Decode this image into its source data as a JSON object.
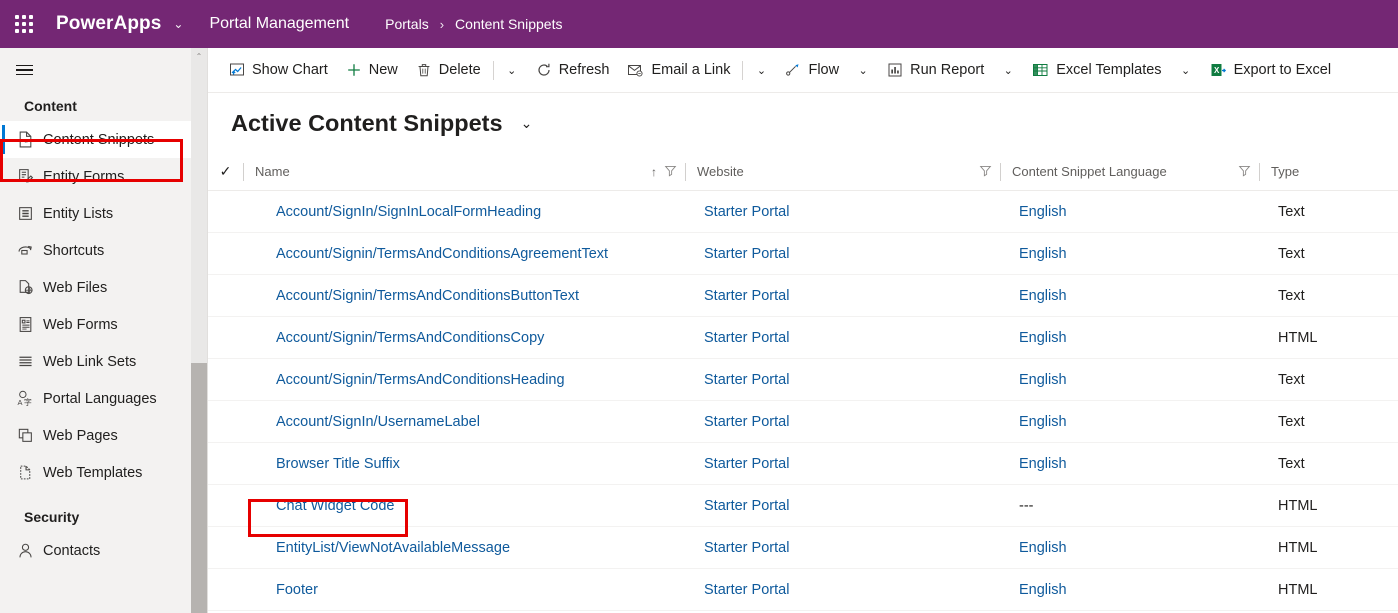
{
  "topbar": {
    "waffle_label": "app-launcher",
    "brand": "PowerApps",
    "brand_chevron": "⌄",
    "app_name": "Portal Management",
    "breadcrumb": {
      "parent": "Portals",
      "separator": "›",
      "current": "Content Snippets"
    },
    "bg_color": "#742774"
  },
  "sidebar": {
    "hamburger_label": "site-map-toggle",
    "sections": [
      {
        "title": "Content",
        "items": [
          {
            "label": "Content Snippets",
            "icon": "code-file-icon",
            "selected": true
          },
          {
            "label": "Entity Forms",
            "icon": "form-edit-icon",
            "selected": false
          },
          {
            "label": "Entity Lists",
            "icon": "list-icon",
            "selected": false
          },
          {
            "label": "Shortcuts",
            "icon": "shortcut-arrow-icon",
            "selected": false
          },
          {
            "label": "Web Files",
            "icon": "web-file-icon",
            "selected": false
          },
          {
            "label": "Web Forms",
            "icon": "web-form-icon",
            "selected": false
          },
          {
            "label": "Web Link Sets",
            "icon": "link-set-icon",
            "selected": false
          },
          {
            "label": "Portal Languages",
            "icon": "language-icon",
            "selected": false
          },
          {
            "label": "Web Pages",
            "icon": "pages-icon",
            "selected": false
          },
          {
            "label": "Web Templates",
            "icon": "template-icon",
            "selected": false
          }
        ]
      },
      {
        "title": "Security",
        "items": [
          {
            "label": "Contacts",
            "icon": "person-icon",
            "selected": false
          }
        ]
      }
    ],
    "scroll_up_arrow": "⌃"
  },
  "commandbar": {
    "items": [
      {
        "label": "Show Chart",
        "icon": "chart-icon",
        "chevron": false,
        "sep_after": false
      },
      {
        "label": "New",
        "icon": "plus-icon",
        "chevron": false,
        "sep_after": false
      },
      {
        "label": "Delete",
        "icon": "trash-icon",
        "chevron": true,
        "sep_before": true
      },
      {
        "label": "Refresh",
        "icon": "refresh-icon",
        "chevron": false
      },
      {
        "label": "Email a Link",
        "icon": "email-link-icon",
        "chevron": true,
        "sep_before": true
      },
      {
        "label": "Flow",
        "icon": "flow-icon",
        "chevron": true
      },
      {
        "label": "Run Report",
        "icon": "report-icon",
        "chevron": true
      },
      {
        "label": "Excel Templates",
        "icon": "excel-template-icon",
        "chevron": true
      },
      {
        "label": "Export to Excel",
        "icon": "excel-export-icon",
        "chevron": false
      }
    ],
    "chevron_glyph": "⌄"
  },
  "view": {
    "title": "Active Content Snippets",
    "chevron": "⌄"
  },
  "grid": {
    "select_all_glyph": "✓",
    "sort_glyph": "↑",
    "columns": [
      {
        "label": "Name",
        "sorted": true,
        "filter": true
      },
      {
        "label": "Website",
        "sorted": false,
        "filter": true
      },
      {
        "label": "Content Snippet Language",
        "sorted": false,
        "filter": true
      },
      {
        "label": "Type",
        "sorted": false,
        "filter": false
      }
    ],
    "rows": [
      {
        "name": "Account/SignIn/SignInLocalFormHeading",
        "website": "Starter Portal",
        "language": "English",
        "type": "Text",
        "highlighted": false
      },
      {
        "name": "Account/Signin/TermsAndConditionsAgreementText",
        "website": "Starter Portal",
        "language": "English",
        "type": "Text",
        "highlighted": false
      },
      {
        "name": "Account/Signin/TermsAndConditionsButtonText",
        "website": "Starter Portal",
        "language": "English",
        "type": "Text",
        "highlighted": false
      },
      {
        "name": "Account/Signin/TermsAndConditionsCopy",
        "website": "Starter Portal",
        "language": "English",
        "type": "HTML",
        "highlighted": false
      },
      {
        "name": "Account/Signin/TermsAndConditionsHeading",
        "website": "Starter Portal",
        "language": "English",
        "type": "Text",
        "highlighted": false
      },
      {
        "name": "Account/SignIn/UsernameLabel",
        "website": "Starter Portal",
        "language": "English",
        "type": "Text",
        "highlighted": false
      },
      {
        "name": "Browser Title Suffix",
        "website": "Starter Portal",
        "language": "English",
        "type": "Text",
        "highlighted": false
      },
      {
        "name": "Chat Widget Code",
        "website": "Starter Portal",
        "language": "---",
        "type": "HTML",
        "highlighted": true
      },
      {
        "name": "EntityList/ViewNotAvailableMessage",
        "website": "Starter Portal",
        "language": "English",
        "type": "HTML",
        "highlighted": false
      },
      {
        "name": "Footer",
        "website": "Starter Portal",
        "language": "English",
        "type": "HTML",
        "highlighted": false
      }
    ]
  },
  "annotations": {
    "highlight_color": "#e60000",
    "boxes": [
      {
        "target": "sidebar-item-content-snippets"
      },
      {
        "target": "row-chat-widget-code"
      }
    ]
  }
}
